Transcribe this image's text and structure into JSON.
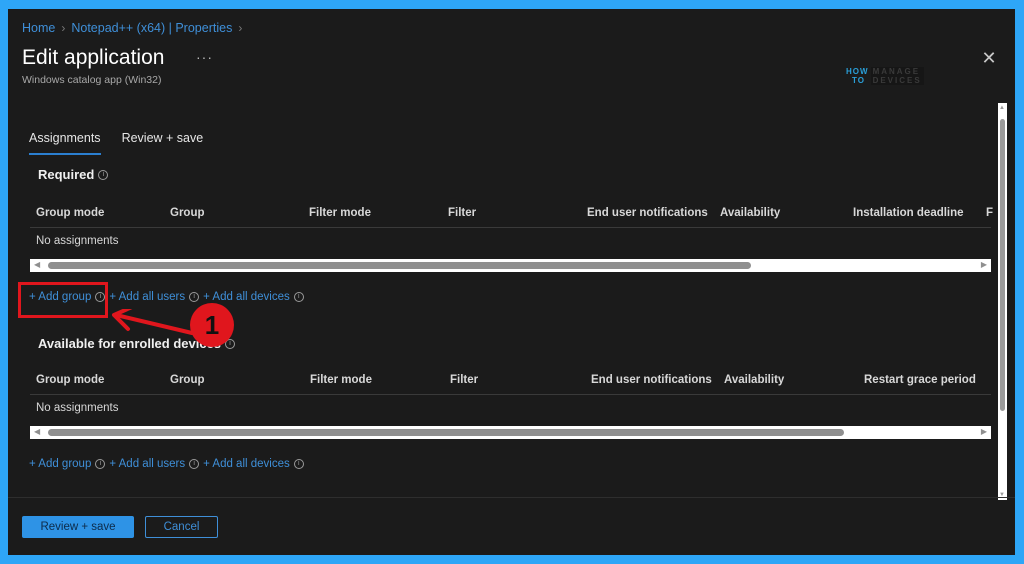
{
  "breadcrumb": [
    {
      "label": "Home"
    },
    {
      "label": "Notepad++ (x64) | Properties"
    }
  ],
  "header": {
    "title": "Edit application",
    "more_label": "···",
    "subtitle": "Windows catalog app (Win32)",
    "close_label": "✕",
    "watermark": {
      "line1": "HOW",
      "line2": "TO",
      "line3": "MANAGE",
      "line4": "DEVICES"
    }
  },
  "tabs": [
    {
      "label": "Assignments",
      "active": true
    },
    {
      "label": "Review + save",
      "active": false
    }
  ],
  "sections": [
    {
      "title": "Required",
      "columns": [
        "Group mode",
        "Group",
        "Filter mode",
        "Filter",
        "End user notifications",
        "Availability",
        "Installation deadline",
        "F"
      ],
      "empty_text": "No assignments",
      "scroll_fraction": 0.76,
      "links": [
        "+ Add group",
        "+ Add all users",
        "+ Add all devices"
      ]
    },
    {
      "title": "Available for enrolled devices",
      "columns": [
        "Group mode",
        "Group",
        "Filter mode",
        "Filter",
        "End user notifications",
        "Availability",
        "Restart grace period"
      ],
      "empty_text": "No assignments",
      "scroll_fraction": 0.86,
      "links": [
        "+ Add group",
        "+ Add all users",
        "+ Add all devices"
      ]
    }
  ],
  "footer": {
    "primary_label": "Review + save",
    "secondary_label": "Cancel"
  },
  "annotation": {
    "step_number": "1",
    "color": "#e0161d"
  },
  "colors": {
    "accent": "#2e93e6",
    "link": "#3f8fd8",
    "background": "#1b1b1b",
    "frame": "#2ea6f7"
  }
}
